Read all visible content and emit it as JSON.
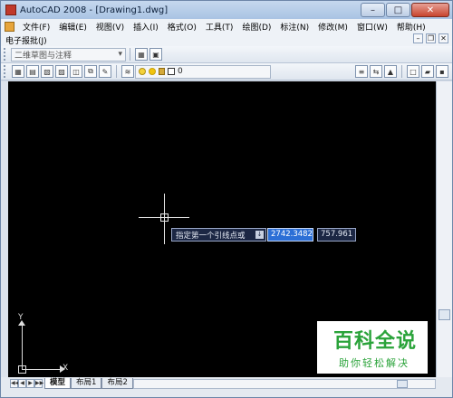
{
  "window": {
    "title": "AutoCAD 2008 - [Drawing1.dwg]",
    "controls": {
      "minimize": "–",
      "maximize": "□",
      "close": "✕"
    }
  },
  "menubar": {
    "items": [
      "文件(F)",
      "编辑(E)",
      "视图(V)",
      "插入(I)",
      "格式(O)",
      "工具(T)",
      "绘图(D)",
      "标注(N)",
      "修改(M)",
      "窗口(W)",
      "帮助(H)"
    ],
    "second_row": [
      "电子报批(J)"
    ],
    "mdi_controls": {
      "minimize": "–",
      "restore": "❐",
      "close": "✕"
    }
  },
  "toolbar1": {
    "workspace": "二维草图与注释",
    "workspace_arrow": "▾"
  },
  "toolbar2": {
    "layer_name": "0"
  },
  "drawing": {
    "dynamic_input": {
      "prompt": "指定第一个引线点或",
      "prompt_arrow": "↓",
      "x_value": "2742.3482",
      "y_value": "757.961"
    },
    "ucs": {
      "x_label": "X",
      "y_label": "Y"
    }
  },
  "tabs": {
    "items": [
      "模型",
      "布局1",
      "布局2"
    ],
    "active": "模型",
    "nav": [
      "◀◀",
      "◀",
      "▶",
      "▶▶"
    ]
  },
  "watermark": {
    "main": "百科全说",
    "sub": "助你轻松解决"
  }
}
